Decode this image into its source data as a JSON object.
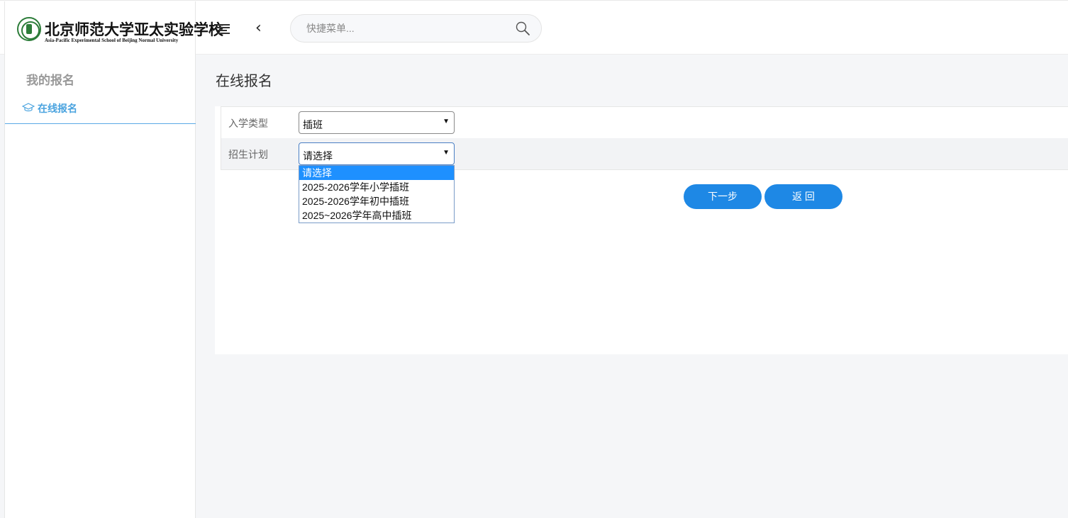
{
  "header": {
    "logo_cn": "北京师范大学亚太实验学校",
    "logo_en": "Asia-Pacific Experimental School of Beijing Normal University",
    "search_placeholder": "快捷菜单..."
  },
  "sidebar": {
    "title": "我的报名",
    "items": [
      {
        "label": "在线报名",
        "icon": "graduation-cap-icon"
      }
    ]
  },
  "main": {
    "title": "在线报名",
    "form": {
      "rows": [
        {
          "label": "入学类型",
          "value": "插班"
        },
        {
          "label": "招生计划",
          "value": "请选择"
        }
      ],
      "dropdown_options": [
        "请选择",
        "2025-2026学年小学插班",
        "2025-2026学年初中插班",
        "2025~2026学年高中插班"
      ]
    },
    "buttons": {
      "next": "下一步",
      "back": "返 回"
    }
  },
  "colors": {
    "accent": "#1e88e5",
    "sidebar_active": "#4aa3df",
    "option_highlight": "#1e90ff"
  }
}
